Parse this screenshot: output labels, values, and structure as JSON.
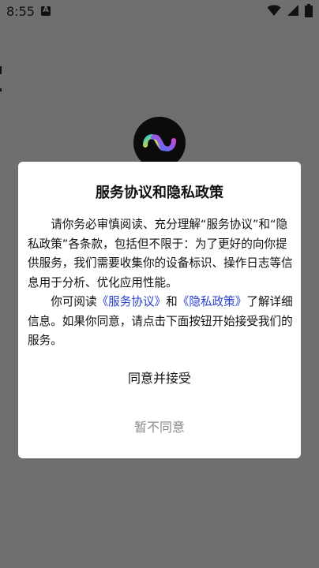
{
  "status_bar": {
    "time": "8:55",
    "notification_icon": "a-notification-icon",
    "wifi_icon": "wifi-icon",
    "signal_icon": "signal-icon",
    "battery_icon": "battery-icon"
  },
  "app_logo": {
    "icon": "app-logo-icon"
  },
  "dialog": {
    "title": "服务协议和隐私政策",
    "paragraph1": "请你务必审慎阅读、充分理解“服务协议”和“隐私政策”各条款，包括但不限于：为了更好的向你提供服务，我们需要收集你的设备标识、操作日志等信息用于分析、优化应用性能。",
    "paragraph2_prefix": "你可阅读",
    "service_agreement_link": "《服务协议》",
    "paragraph2_and": "和",
    "privacy_policy_link": "《隐私政策》",
    "paragraph2_suffix": "了解详细信息。如果你同意，请点击下面按钮开始接受我们的服务。",
    "accept_label": "同意并接受",
    "decline_label": "暂不同意"
  },
  "colors": {
    "overlay_background": "#6f6f6f",
    "dialog_background": "#ffffff",
    "link_color": "#2a3fd0",
    "decline_color": "#8a8a8a"
  }
}
